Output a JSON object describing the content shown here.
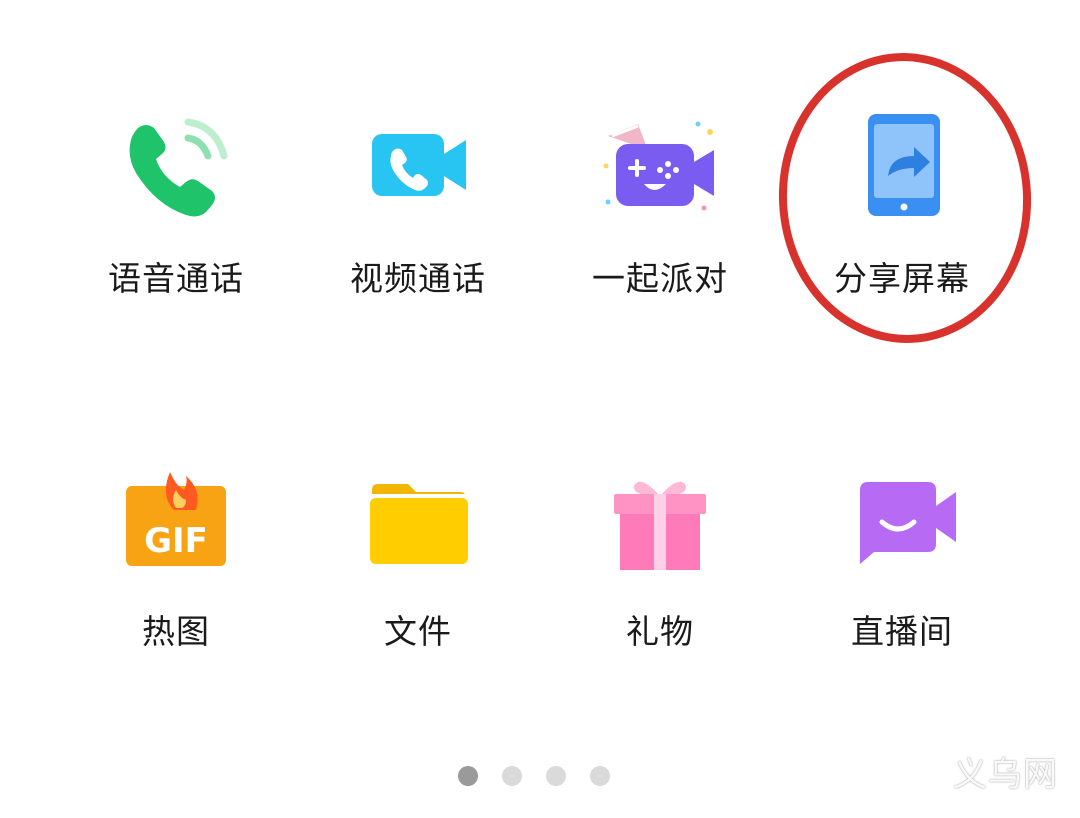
{
  "grid": {
    "row1": [
      {
        "label": "语音通话",
        "icon": "voice-call-icon"
      },
      {
        "label": "视频通话",
        "icon": "video-call-icon"
      },
      {
        "label": "一起派对",
        "icon": "party-game-icon"
      },
      {
        "label": "分享屏幕",
        "icon": "share-screen-icon"
      }
    ],
    "row2": [
      {
        "label": "热图",
        "icon": "gif-hot-icon"
      },
      {
        "label": "文件",
        "icon": "folder-icon"
      },
      {
        "label": "礼物",
        "icon": "gift-icon"
      },
      {
        "label": "直播间",
        "icon": "live-room-icon"
      }
    ]
  },
  "highlight": {
    "target": "分享屏幕",
    "color": "#d8322d"
  },
  "pager": {
    "pages": 4,
    "active_index": 0
  },
  "watermark": {
    "text": "义乌网"
  },
  "colors": {
    "voice_green": "#1fc36a",
    "video_blue": "#28c4f2",
    "party_purple": "#7b5cf0",
    "share_blue": "#3a90f2",
    "gif_orange": "#f7a313",
    "folder_yellow": "#ffc700",
    "gift_pink": "#ff7ab8",
    "live_purple": "#b76bf5"
  }
}
